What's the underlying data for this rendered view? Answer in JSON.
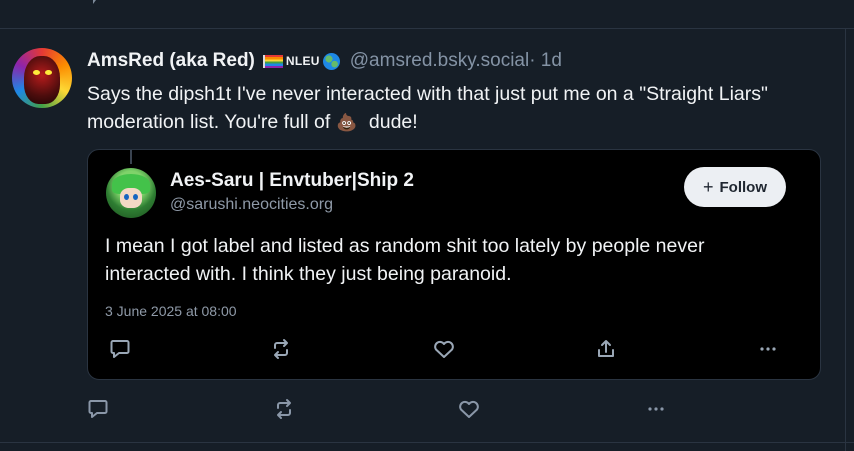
{
  "post": {
    "author": {
      "display_name": "AmsRed (aka Red)",
      "flag_label": "NLEU",
      "handle": "@amsred.bsky.social",
      "time": " · 1d"
    },
    "text_before_emoji": "Says the dipsh1t I've never interacted with that just put me on a \"Straight Liars\" moderation list. You're full of",
    "emoji": "💩",
    "text_after_emoji": " dude!"
  },
  "quote": {
    "author": {
      "display_name": "Aes-Saru | Envtuber|Ship 2",
      "handle": "@sarushi.neocities.org"
    },
    "follow_button": {
      "icon": "+",
      "label": "Follow"
    },
    "text": "I mean I got label and listed as random shit too lately by people never interacted with. I think they just being paranoid.",
    "date": "3 June 2025 at 08:00",
    "actions": [
      "reply-icon",
      "repost-icon",
      "like-icon",
      "share-icon",
      "more-icon"
    ]
  },
  "post_actions": [
    "reply-icon",
    "repost-icon",
    "like-icon",
    "more-icon"
  ],
  "colors": {
    "background": "#161e27",
    "quote_background": "#000000",
    "border": "#2a3441",
    "muted_text": "#8493a5",
    "follow_button_bg": "#eceff3"
  }
}
